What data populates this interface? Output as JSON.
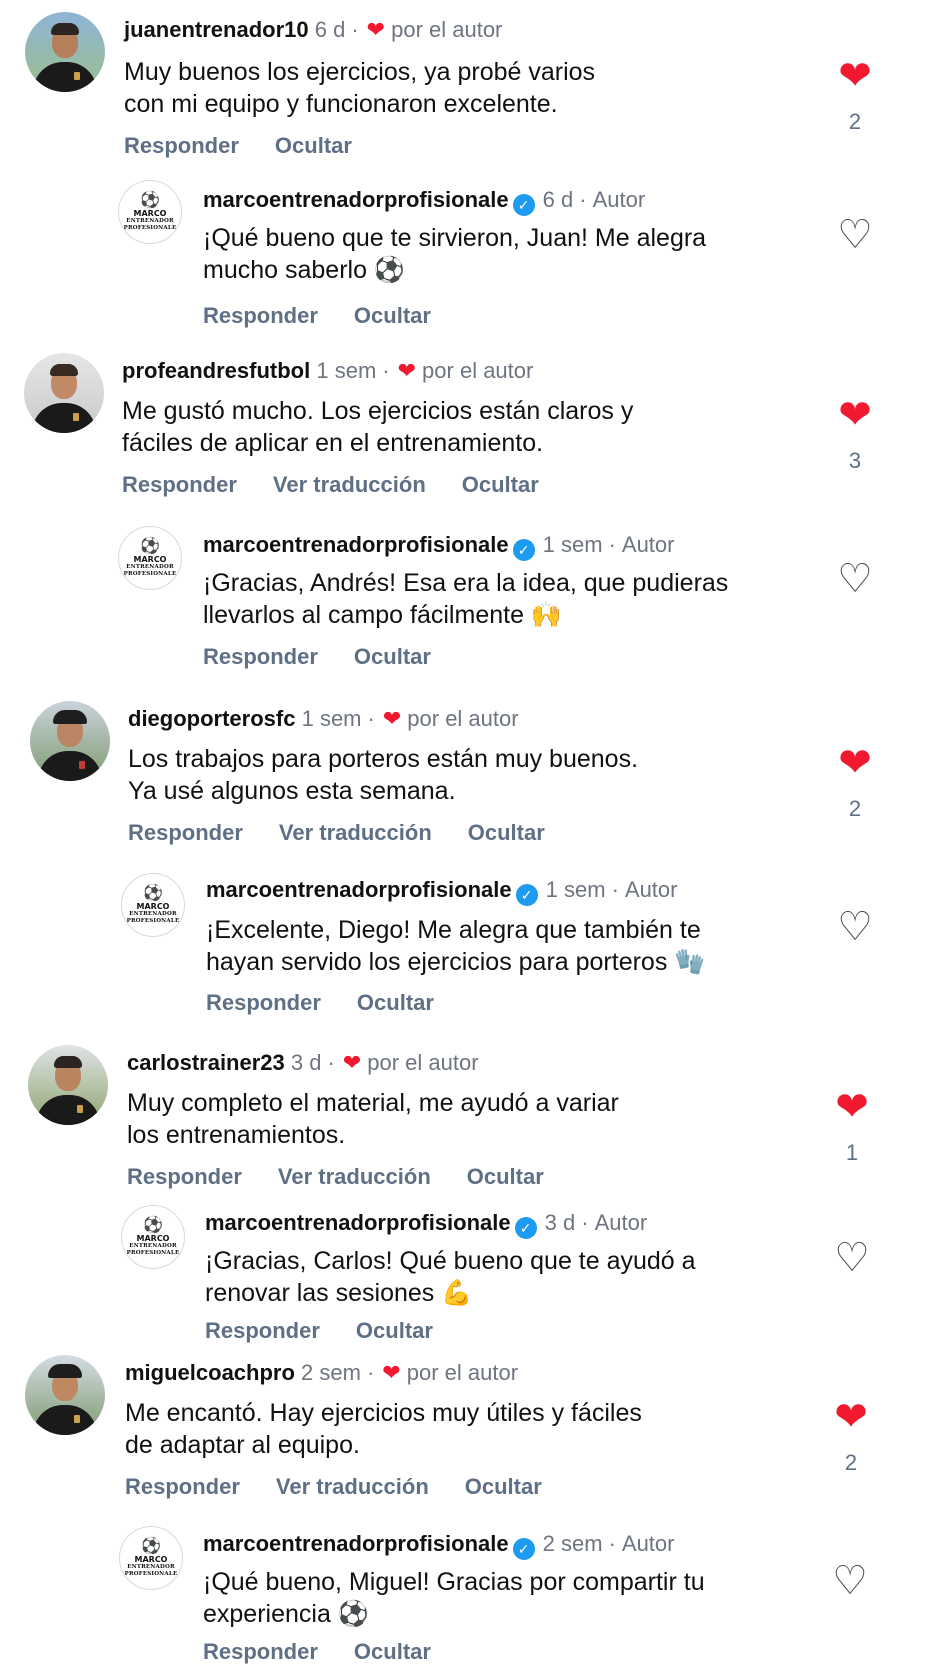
{
  "actions": {
    "reply": "Responder",
    "hide": "Ocultar",
    "translate": "Ver traducción"
  },
  "labels": {
    "by_author": "por el autor",
    "author": "Autor"
  },
  "author_avatar": {
    "line1": "MARCO",
    "line2": "ENTRENADOR",
    "line3": "PROFESIONALE"
  },
  "colors": {
    "like_red": "#f0192f",
    "verified_blue": "#1d9bf0",
    "action_gray": "#5e6f86"
  },
  "threads": [
    {
      "comment": {
        "user": "juanentrenador10",
        "time": "6 d",
        "text": "Muy buenos los ejercicios, ya probé varios\ncon mi equipo y funcionaron excelente.",
        "likes": "2"
      },
      "reply": {
        "user": "marcoentrenadorprofisionale",
        "time": "6 d",
        "text": "¡Qué bueno que te sirvieron, Juan! Me alegra\nmucho saberlo ⚽"
      }
    },
    {
      "comment": {
        "user": "profeandresfutbol",
        "time": "1 sem",
        "text": "Me gustó mucho. Los ejercicios están claros y\nfáciles de aplicar en el entrenamiento.",
        "likes": "3"
      },
      "reply": {
        "user": "marcoentrenadorprofisionale",
        "time": "1 sem",
        "text": "¡Gracias, Andrés! Esa era la idea, que pudieras\nllevarlos al campo fácilmente 🙌"
      }
    },
    {
      "comment": {
        "user": "diegoporterosfc",
        "time": "1 sem",
        "text": "Los trabajos para porteros están muy buenos.\nYa usé algunos esta semana.",
        "likes": "2"
      },
      "reply": {
        "user": "marcoentrenadorprofisionale",
        "time": "1 sem",
        "text": "¡Excelente, Diego! Me alegra que también te\nhayan servido los ejercicios para porteros 🧤"
      }
    },
    {
      "comment": {
        "user": "carlostrainer23",
        "time": "3 d",
        "text": "Muy completo el material, me ayudó a variar\nlos entrenamientos.",
        "likes": "1"
      },
      "reply": {
        "user": "marcoentrenadorprofisionale",
        "time": "3 d",
        "text": "¡Gracias, Carlos! Qué bueno que te ayudó a\nrenovar las sesiones 💪"
      }
    },
    {
      "comment": {
        "user": "miguelcoachpro",
        "time": "2 sem",
        "text": "Me encantó. Hay ejercicios muy útiles y fáciles\nde adaptar al equipo.",
        "likes": "2"
      },
      "reply": {
        "user": "marcoentrenadorprofisionale",
        "time": "2 sem",
        "text": "¡Qué bueno, Miguel! Gracias por compartir tu\nexperiencia ⚽"
      }
    }
  ]
}
